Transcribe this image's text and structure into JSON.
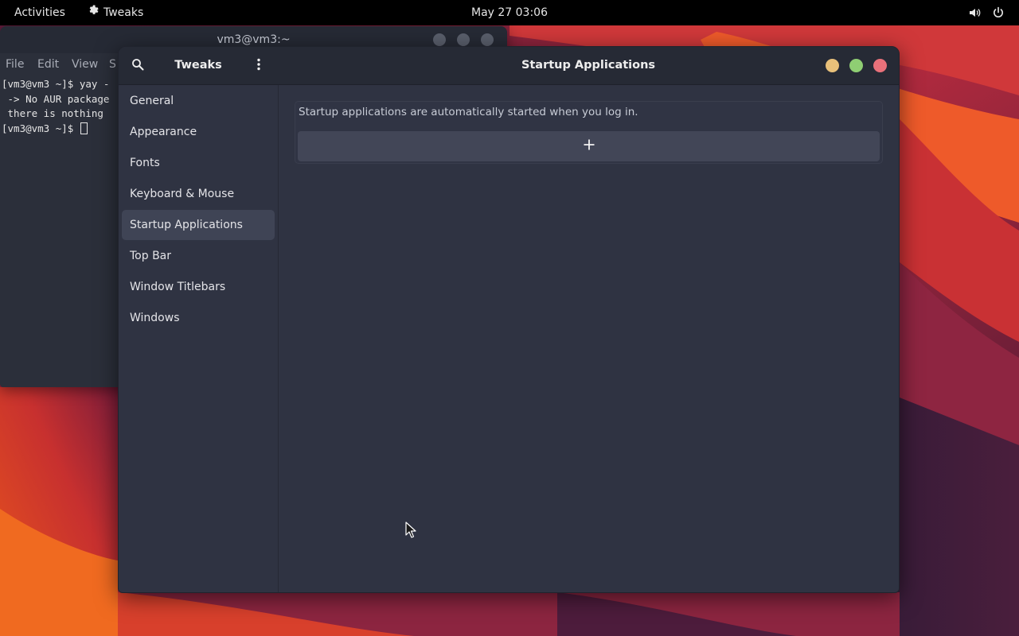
{
  "topbar": {
    "activities": "Activities",
    "app_name": "Tweaks",
    "clock": "May 27  03:06",
    "icons": {
      "app": "gear-icon",
      "volume": "volume-icon",
      "power": "power-icon"
    }
  },
  "terminal": {
    "title": "vm3@vm3:~",
    "menu": [
      "File",
      "Edit",
      "View",
      "S"
    ],
    "lines": [
      "[vm3@vm3 ~]$ yay -",
      " -> No AUR package",
      " there is nothing ",
      "[vm3@vm3 ~]$ "
    ]
  },
  "tweaks": {
    "app_title": "Tweaks",
    "page_title": "Startup Applications",
    "sidebar": {
      "items": [
        {
          "label": "General"
        },
        {
          "label": "Appearance"
        },
        {
          "label": "Fonts"
        },
        {
          "label": "Keyboard & Mouse"
        },
        {
          "label": "Startup Applications",
          "active": true
        },
        {
          "label": "Top Bar"
        },
        {
          "label": "Window Titlebars"
        },
        {
          "label": "Windows"
        }
      ]
    },
    "content": {
      "description": "Startup applications are automatically started when you log in.",
      "add_icon": "plus-icon"
    },
    "controls": {
      "minimize_color": "#e8c07a",
      "maximize_color": "#8fce73",
      "close_color": "#e9717a"
    }
  },
  "colors": {
    "topbar_bg": "#000000",
    "window_bg": "#2f3342",
    "header_bg": "#262a35",
    "selected_bg": "#3f4455",
    "wallpaper_accent": "#e3541f"
  }
}
